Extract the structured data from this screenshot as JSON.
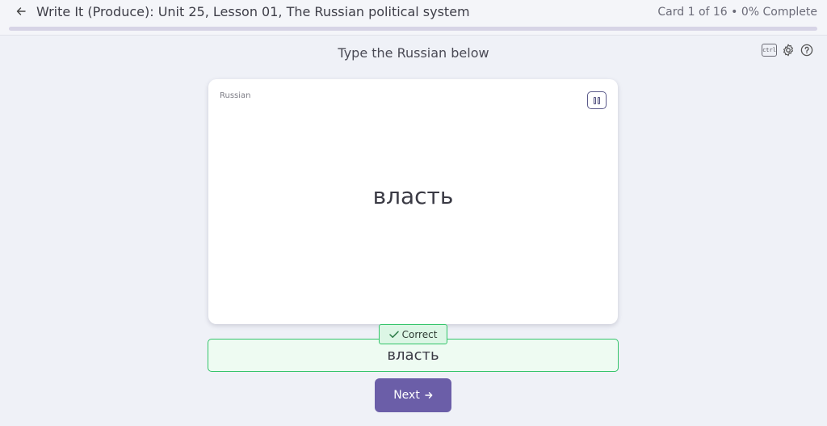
{
  "header": {
    "back_icon": "arrow-left-icon",
    "title": "Write It (Produce): Unit 25, Lesson 01, The Russian political system",
    "progress_text": "Card 1 of 16 • 0% Complete",
    "progress_fraction": 0.0
  },
  "tools": {
    "ctrl_label": "ctrl",
    "settings_icon": "gear-icon",
    "help_icon": "help-circle-icon"
  },
  "instruction": "Type the Russian below",
  "card": {
    "language_label": "Russian",
    "word": "власть",
    "audio_icon": "pause-icon"
  },
  "answer": {
    "value": "власть",
    "status_label": "Correct",
    "status_icon": "check-icon"
  },
  "next_button": {
    "label": "Next",
    "icon": "arrow-right-icon"
  },
  "colors": {
    "accent": "#6b5ea8",
    "correct_border": "#34c46a",
    "correct_bg": "#eefbf2"
  }
}
